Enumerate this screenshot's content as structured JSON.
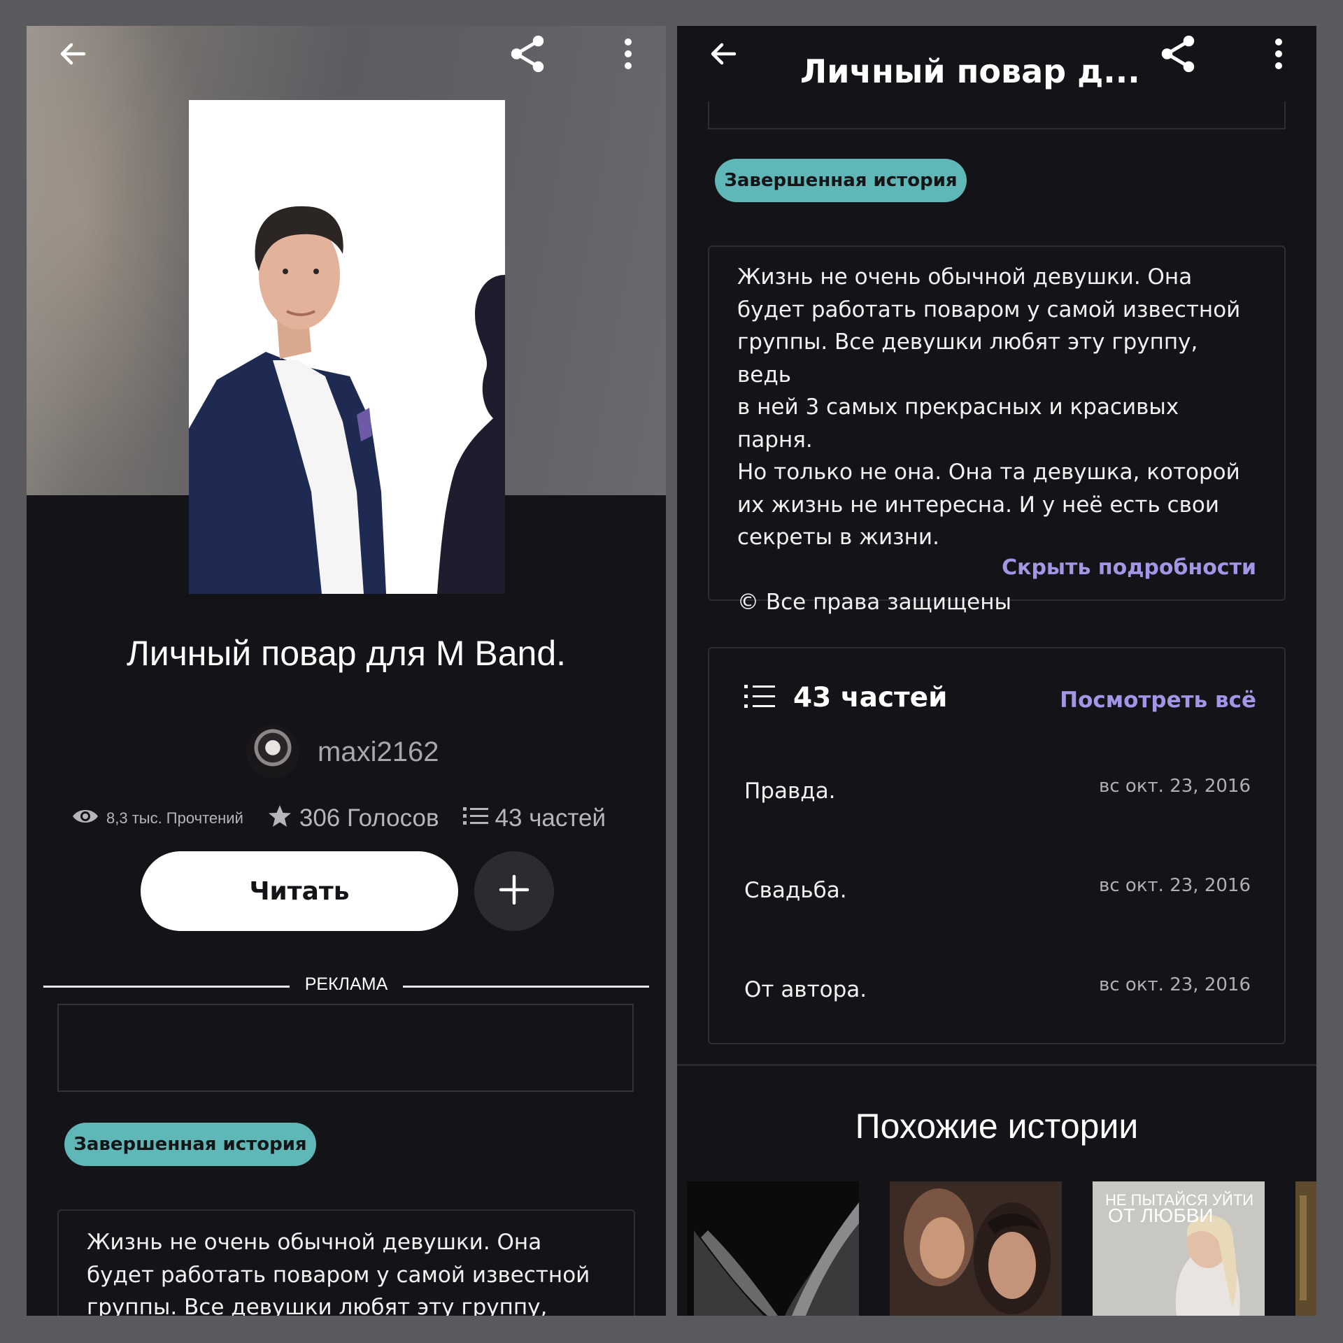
{
  "left": {
    "story_title": "Личный повар для M Band.",
    "author": "maxi2162",
    "stats": {
      "reads": "8,3 тыс. Прочтений",
      "votes": "306 Голосов",
      "parts": "43 частей"
    },
    "read_button": "Читать",
    "ad_label": "РЕКЛАМА",
    "status_badge": "Завершенная история",
    "description_lines": [
      "Жизнь не очень обычной девушки. Она",
      "будет работать поваром у самой известной",
      "группы. Все девушки любят эту группу, ведь"
    ]
  },
  "right": {
    "header_title": "Личный повар д...",
    "status_badge": "Завершенная история",
    "description": "Жизнь не очень обычной девушки. Она\nбудет работать поваром у самой известной\nгруппы. Все девушки любят эту группу, ведь\nв ней 3 самых прекрасных и красивых парня.\nНо только не она. Она та девушка, которой\nих жизнь не интересна. И у неё есть свои\nсекреты в жизни.",
    "copyright": "© Все права защищены",
    "hide_details": "Скрыть подробности",
    "parts_count": "43 частей",
    "see_all": "Посмотреть всё",
    "parts": [
      {
        "title": "Правда.",
        "date": "вс окт. 23, 2016"
      },
      {
        "title": "Свадьба.",
        "date": "вс окт. 23, 2016"
      },
      {
        "title": "От автора.",
        "date": "вс окт. 23, 2016"
      }
    ],
    "similar_title": "Похожие истории",
    "similar_cover_text": [
      "НЕ ПЫТАЙСЯ УЙТИ",
      "ОТ ЛЮБВИ"
    ]
  },
  "icons": [
    "back-arrow-icon",
    "share-icon",
    "more-vertical-icon",
    "eye-icon",
    "star-icon",
    "list-icon",
    "plus-icon"
  ],
  "colors": {
    "background": "#141317",
    "badge": "#5fb7b8",
    "link": "#a396e6",
    "frame": "#5a595e"
  }
}
